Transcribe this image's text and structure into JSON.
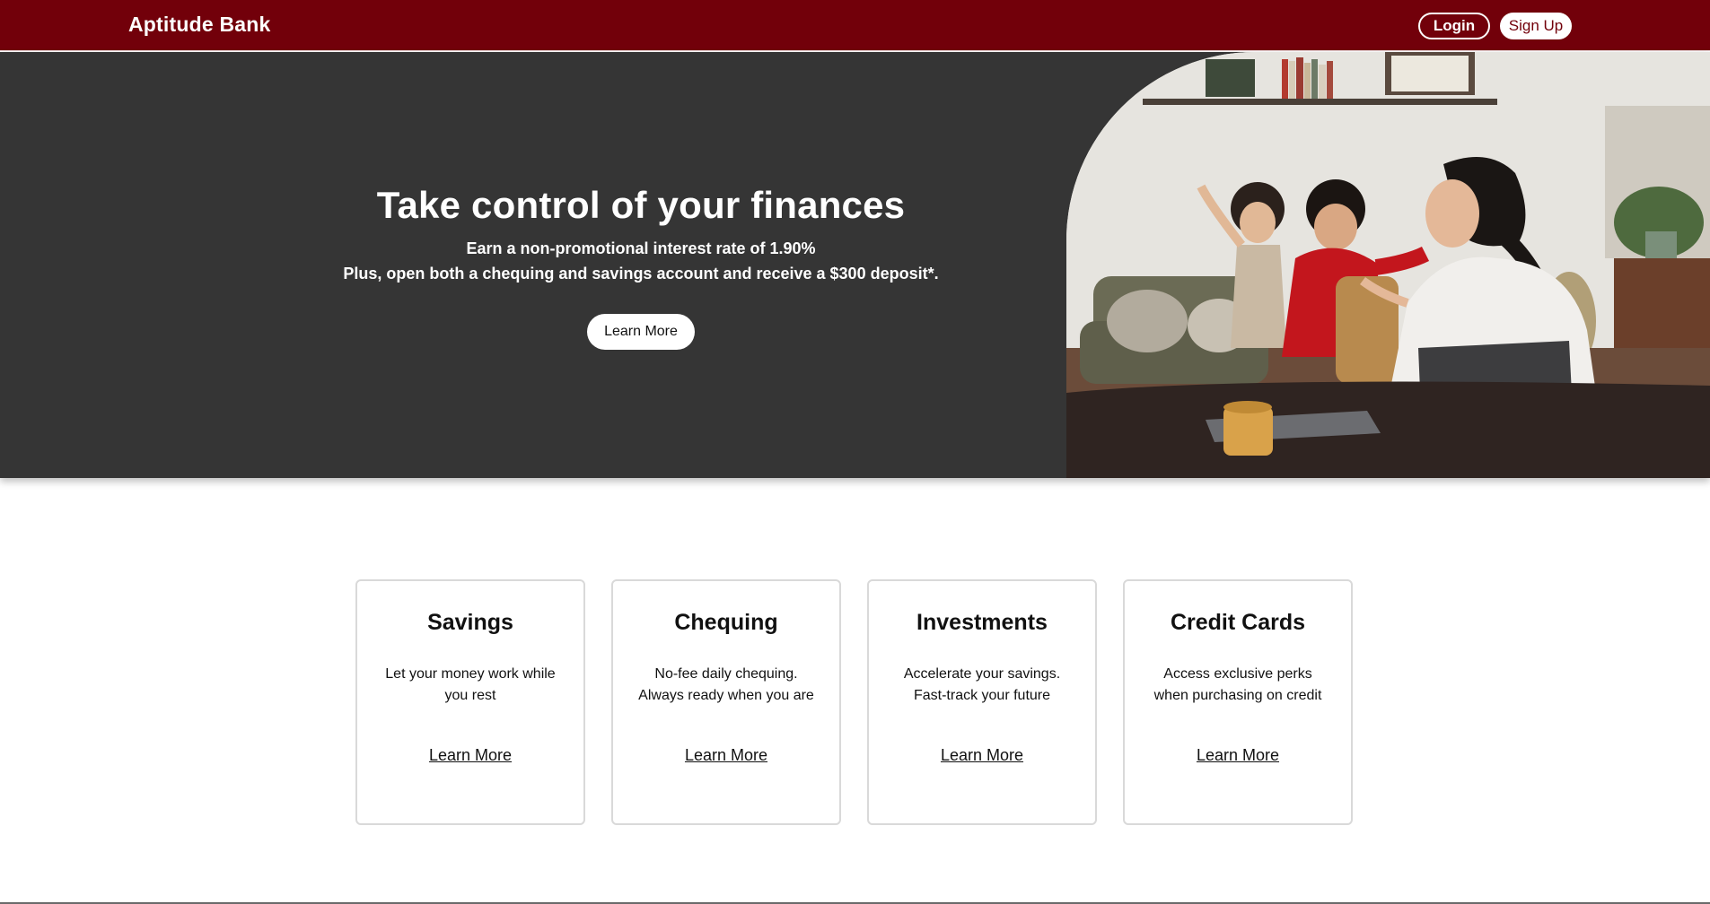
{
  "header": {
    "brand": "Aptitude Bank",
    "login_label": "Login",
    "signup_label": "Sign Up"
  },
  "hero": {
    "title": "Take control of your finances",
    "line1": "Earn a non-promotional interest rate of 1.90%",
    "line2": "Plus, open both a chequing and savings account and receive a $300 deposit*.",
    "cta_label": "Learn More",
    "image_alt": "Mother working on a laptop at home while two children play"
  },
  "cards": [
    {
      "title": "Savings",
      "desc": "Let your money work while you rest",
      "link": "Learn More"
    },
    {
      "title": "Chequing",
      "desc": "No-fee daily chequing. Always ready when you are",
      "link": "Learn More"
    },
    {
      "title": "Investments",
      "desc": "Accelerate your savings. Fast-track your future",
      "link": "Learn More"
    },
    {
      "title": "Credit Cards",
      "desc": "Access exclusive perks when purchasing on credit",
      "link": "Learn More"
    }
  ],
  "colors": {
    "brand": "#72000a",
    "hero_bg": "#353535"
  }
}
